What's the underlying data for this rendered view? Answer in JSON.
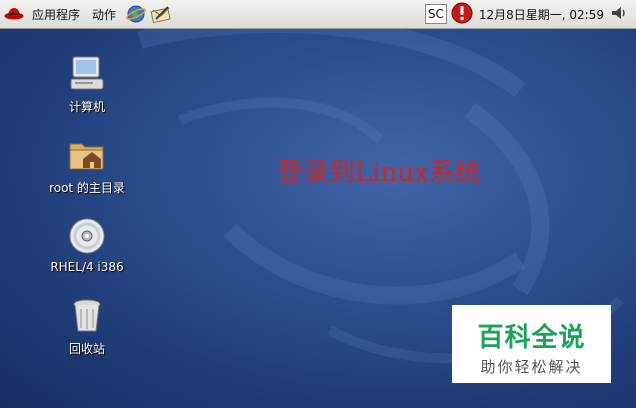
{
  "panel": {
    "menu_apps": "应用程序",
    "menu_actions": "动作",
    "input_method": "SC",
    "clock": "12月8日星期一, 02:59"
  },
  "desktop_icons": [
    {
      "label": "计算机",
      "icon": "computer-icon"
    },
    {
      "label": "root 的主目录",
      "icon": "home-folder-icon"
    },
    {
      "label": "RHEL/4 i386",
      "icon": "cdrom-icon"
    },
    {
      "label": "回收站",
      "icon": "trash-icon"
    }
  ],
  "overlay_title": "登录到Linux系统",
  "watermark": {
    "main": "百科全说",
    "sub": "助你轻松解决"
  },
  "colors": {
    "panel_bg": "#e6e6e2",
    "desktop_bg": "#2d4f8f",
    "overlay_text": "#d02525",
    "watermark_text": "#1aa35a"
  }
}
